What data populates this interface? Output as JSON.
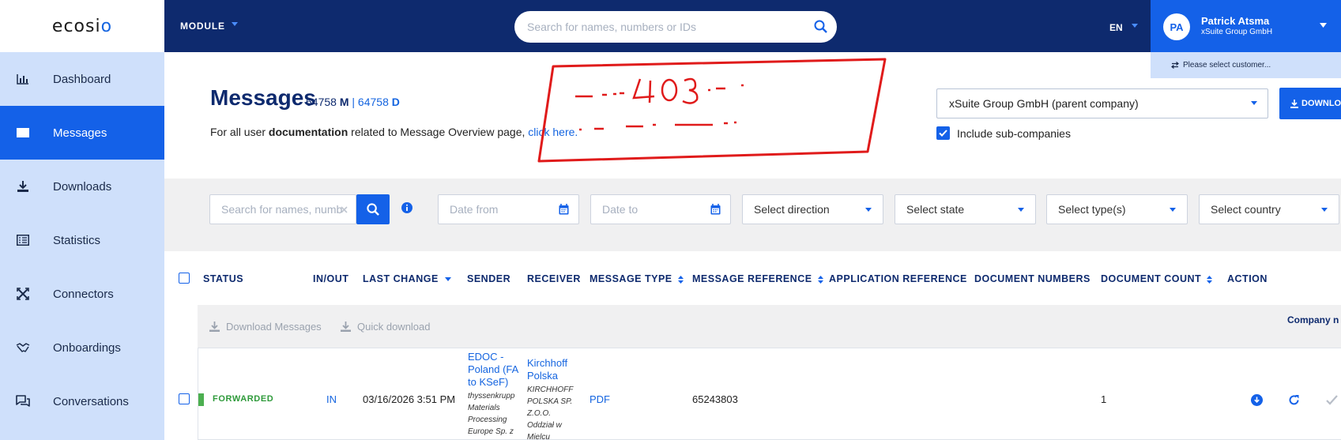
{
  "app": {
    "logo_prefix": "ecosi",
    "logo_suffix": "o"
  },
  "sidebar": {
    "items": [
      {
        "label": "Dashboard",
        "icon": "bar-chart-icon"
      },
      {
        "label": "Messages",
        "icon": "envelope-icon",
        "active": true
      },
      {
        "label": "Downloads",
        "icon": "download-icon"
      },
      {
        "label": "Statistics",
        "icon": "list-icon"
      },
      {
        "label": "Connectors",
        "icon": "connectors-icon"
      },
      {
        "label": "Onboardings",
        "icon": "handshake-icon"
      },
      {
        "label": "Conversations",
        "icon": "chat-icon"
      }
    ]
  },
  "topbar": {
    "module_label": "MODULE",
    "search_placeholder": "Search for names, numbers or IDs",
    "language": "EN",
    "user": {
      "initials": "PA",
      "name": "Patrick Atsma",
      "company": "xSuite Group GmbH"
    },
    "customer_prompt": "Please select customer..."
  },
  "header": {
    "title": "Messages",
    "count_m": "64758",
    "count_m_unit": "M",
    "separator": "|",
    "count_d": "64758",
    "count_d_unit": "D",
    "doc_prefix": "For all user ",
    "doc_bold": "documentation",
    "doc_middle": " related to Message Overview page, ",
    "doc_link": "click here."
  },
  "company_selector": {
    "value": "xSuite Group GmbH (parent company)",
    "download_label": "DOWNLO",
    "include_sub_label": "Include sub-companies",
    "include_sub_checked": true
  },
  "filters": {
    "search_placeholder": "Search for names, numb",
    "date_from": "Date from",
    "date_to": "Date to",
    "direction": "Select direction",
    "state": "Select state",
    "types": "Select type(s)",
    "country": "Select country"
  },
  "table": {
    "columns": [
      "STATUS",
      "IN/OUT",
      "LAST CHANGE",
      "SENDER",
      "RECEIVER",
      "MESSAGE TYPE",
      "MESSAGE REFERENCE",
      "APPLICATION REFERENCE",
      "DOCUMENT NUMBERS",
      "DOCUMENT COUNT",
      "ACTION"
    ],
    "actions": {
      "download_messages": "Download Messages",
      "quick_download": "Quick download",
      "company_hint": "Company n"
    },
    "rows": [
      {
        "status": "FORWARDED",
        "status_color": "#4caf50",
        "direction": "IN",
        "last_change": "03/16/2026 3:51 PM",
        "sender_link": "EDOC - Poland (FA to KSeF)",
        "sender_lines": [
          "EDOC -",
          "Poland (FA",
          "to KSeF)"
        ],
        "sender_company_lines": [
          "thyssenkrupp",
          "Materials",
          "Processing",
          "Europe Sp. z"
        ],
        "receiver_lines": [
          "Kirchhoff",
          "Polska"
        ],
        "receiver_company_lines": [
          "KIRCHHOFF",
          "POLSKA SP.",
          "Z.O.O.",
          "Oddział w",
          "Mielcu"
        ],
        "message_type": "PDF",
        "message_reference": "65243803",
        "document_count": "1"
      }
    ]
  },
  "colors": {
    "navy": "#0e2a6e",
    "primary_blue": "#1461e8",
    "sidebar_bg": "#cfe0fb",
    "scribble_red": "#e01b1b"
  }
}
